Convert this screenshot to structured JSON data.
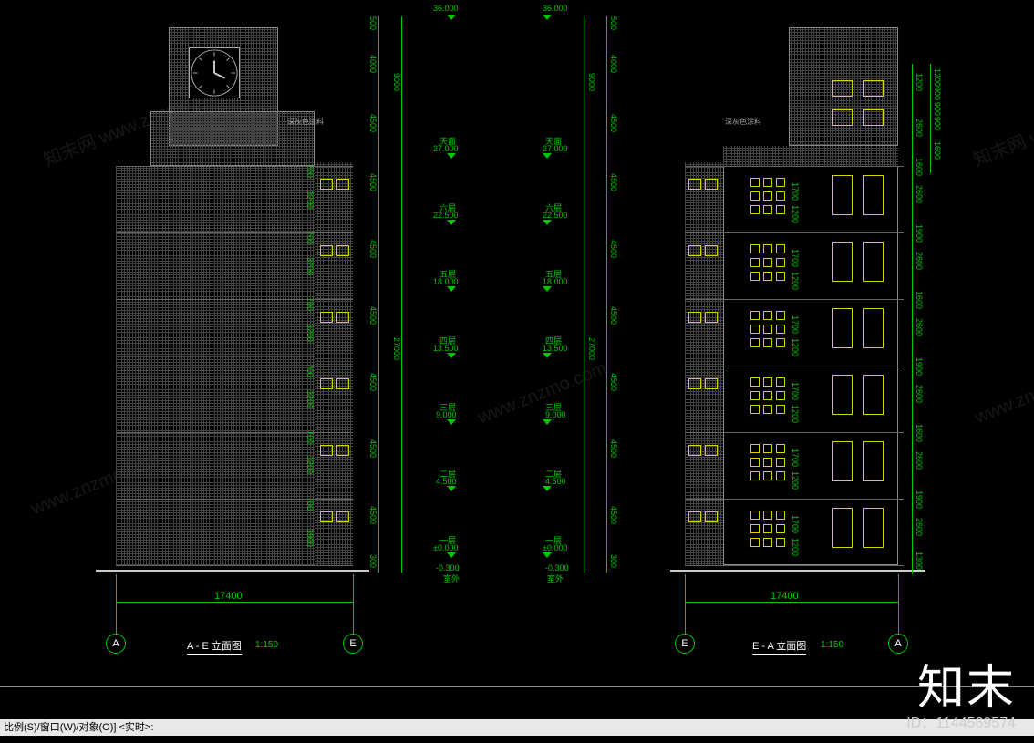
{
  "watermarks": {
    "brand": "知末",
    "id_label": "ID：1144569574",
    "diag1": "www.znzmo.com",
    "diag2": "知末网 www.znzmo.com"
  },
  "statusbar": {
    "text": "比例(S)/窗口(W)/对象(O)] <实时>:"
  },
  "grid_labels": {
    "A": "A",
    "E": "E"
  },
  "left_view": {
    "title": "A - E 立面图",
    "scale": "1:150",
    "width_dim": "17400",
    "annotation": "深灰色涂料"
  },
  "right_view": {
    "title": "E - A 立面图",
    "scale": "1:150",
    "width_dim": "17400",
    "annotation": "深灰色涂料"
  },
  "levels": [
    {
      "name": "室外",
      "elev": "-0.300"
    },
    {
      "name": "一层",
      "elev": "±0.000"
    },
    {
      "name": "二层",
      "elev": "4.500"
    },
    {
      "name": "三层",
      "elev": "9.000"
    },
    {
      "name": "四层",
      "elev": "13.500"
    },
    {
      "name": "五层",
      "elev": "18.000"
    },
    {
      "name": "六层",
      "elev": "22.500"
    },
    {
      "name": "天面",
      "elev": "27.000"
    },
    {
      "name": "",
      "elev": "36.000"
    }
  ],
  "vert_dims_outer": [
    "300",
    "4500",
    "4500",
    "4500",
    "4500",
    "4500",
    "4500",
    "4500",
    "4000",
    "500"
  ],
  "vert_dims_sum": [
    "27000",
    "9000"
  ],
  "vert_dims_right": [
    "1200",
    "2600",
    "1600",
    "2600",
    "1900",
    "2600",
    "1600",
    "2600",
    "1900",
    "2600",
    "1600",
    "2600",
    "1900",
    "2600",
    "1300"
  ],
  "vert_dims_right2": [
    "1200",
    "900",
    "900",
    "900",
    "1600"
  ],
  "floor_side_dims": [
    "3900",
    "700",
    "3200",
    "700",
    "3200",
    "700",
    "3200",
    "700",
    "3200",
    "700",
    "3200",
    "700"
  ],
  "window_pair_dims": [
    "1700",
    "1200"
  ]
}
